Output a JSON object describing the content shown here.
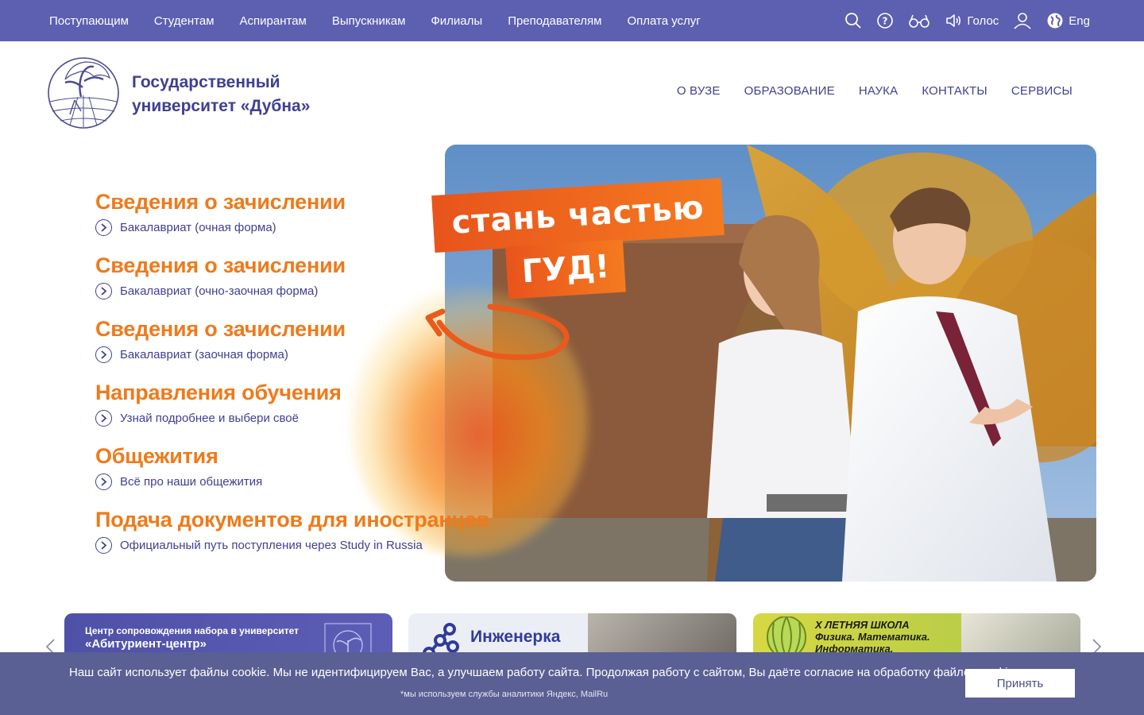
{
  "topbar": {
    "nav": [
      "Поступающим",
      "Студентам",
      "Аспирантам",
      "Выпускникам",
      "Филиалы",
      "Преподавателям",
      "Оплата услуг"
    ],
    "voice_label": "Голос",
    "lang_label": "Eng"
  },
  "header": {
    "brand_line1": "Государственный",
    "brand_line2": "университет «Дубна»",
    "nav": [
      "О ВУЗЕ",
      "ОБРАЗОВАНИЕ",
      "НАУКА",
      "КОНТАКТЫ",
      "СЕРВИСЫ"
    ]
  },
  "hero": {
    "items": [
      {
        "title": "Сведения о зачислении",
        "subtitle": "Бакалавриат (очная форма)"
      },
      {
        "title": "Сведения о зачислении",
        "subtitle": "Бакалавриат (очно-заочная форма)"
      },
      {
        "title": "Сведения о зачислении",
        "subtitle": "Бакалавриат (заочная форма)"
      },
      {
        "title": "Направления обучения",
        "subtitle": "Узнай подробнее и выбери своё"
      },
      {
        "title": "Общежития",
        "subtitle": "Всё про наши общежития"
      },
      {
        "title": "Подача документов для иностранцев",
        "subtitle": "Официальный путь поступления через Study in Russia"
      }
    ],
    "sticker_line1": "стань частью",
    "sticker_line2": "ГУД!"
  },
  "carousel": {
    "card1_line1": "Центр сопровождения набора в университет",
    "card1_line2": "«Абитуриент-центр»",
    "card2_title": "Инженерка",
    "card3_line1": "Х ЛЕТНЯЯ ШКОЛА",
    "card3_line2": "Физика. Математика.",
    "card3_line3": "Информатика."
  },
  "cookie": {
    "text": "Наш сайт использует файлы cookie. Мы не идентифицируем Вас, а улучшаем работу сайта. Продолжая работу с сайтом, Вы даёте согласие на обработку файлов cookie.",
    "note": "*мы используем службы аналитики Яндекс, MailRu",
    "accept_label": "Принять"
  },
  "colors": {
    "topbar": "#5d5fb0",
    "brand": "#3f3f92",
    "accent": "#ef7a1a",
    "cookie_bg": "#5a5f94"
  }
}
